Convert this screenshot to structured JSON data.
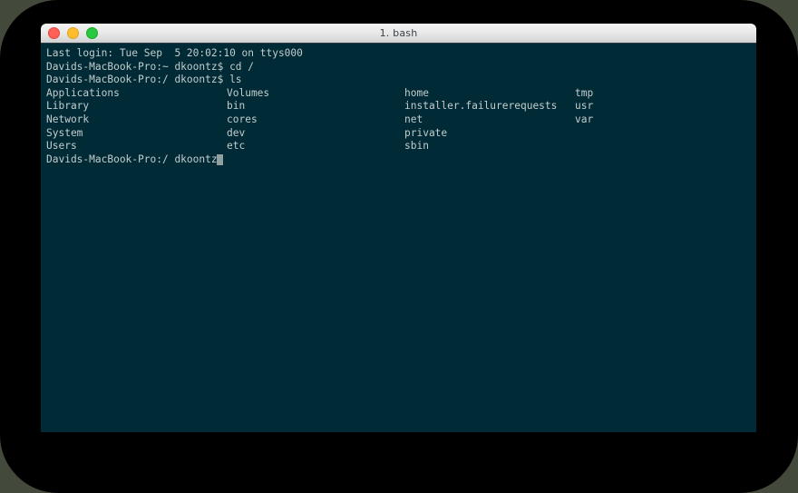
{
  "window": {
    "title": "1. bash",
    "traffic_lights": [
      {
        "name": "close",
        "color": "#ff5f57"
      },
      {
        "name": "minimize",
        "color": "#ffbd2e"
      },
      {
        "name": "zoom",
        "color": "#28c840"
      }
    ]
  },
  "theme": {
    "terminal_background": "#002b36",
    "terminal_foreground": "#c3cdcd",
    "titlebar_background": "#eaeaea",
    "titlebar_foreground": "#3c4043",
    "cursor_color": "#8fa0a0",
    "outer_frame": "#000000",
    "desktop_background": "#434a3c"
  },
  "terminal": {
    "lines": [
      {
        "col1": "Last login: Tue Sep  5 20:02:10 on ttys000"
      },
      {
        "col1": "Davids-MacBook-Pro:~ dkoontz$ cd /"
      },
      {
        "col1": "Davids-MacBook-Pro:/ dkoontz$ ls"
      },
      {
        "col1": "Applications",
        "col2": "Volumes",
        "col3": "home",
        "col4": "tmp"
      },
      {
        "col1": "Library",
        "col2": "bin",
        "col3": "installer.failurerequests",
        "col4": "usr"
      },
      {
        "col1": "Network",
        "col2": "cores",
        "col3": "net",
        "col4": "var"
      },
      {
        "col1": "System",
        "col2": "dev",
        "col3": "private",
        "col4": ""
      },
      {
        "col1": "Users",
        "col2": "etc",
        "col3": "sbin",
        "col4": ""
      }
    ],
    "prompt": "Davids-MacBook-Pro:/ dkoontz$",
    "cursor": "block"
  }
}
